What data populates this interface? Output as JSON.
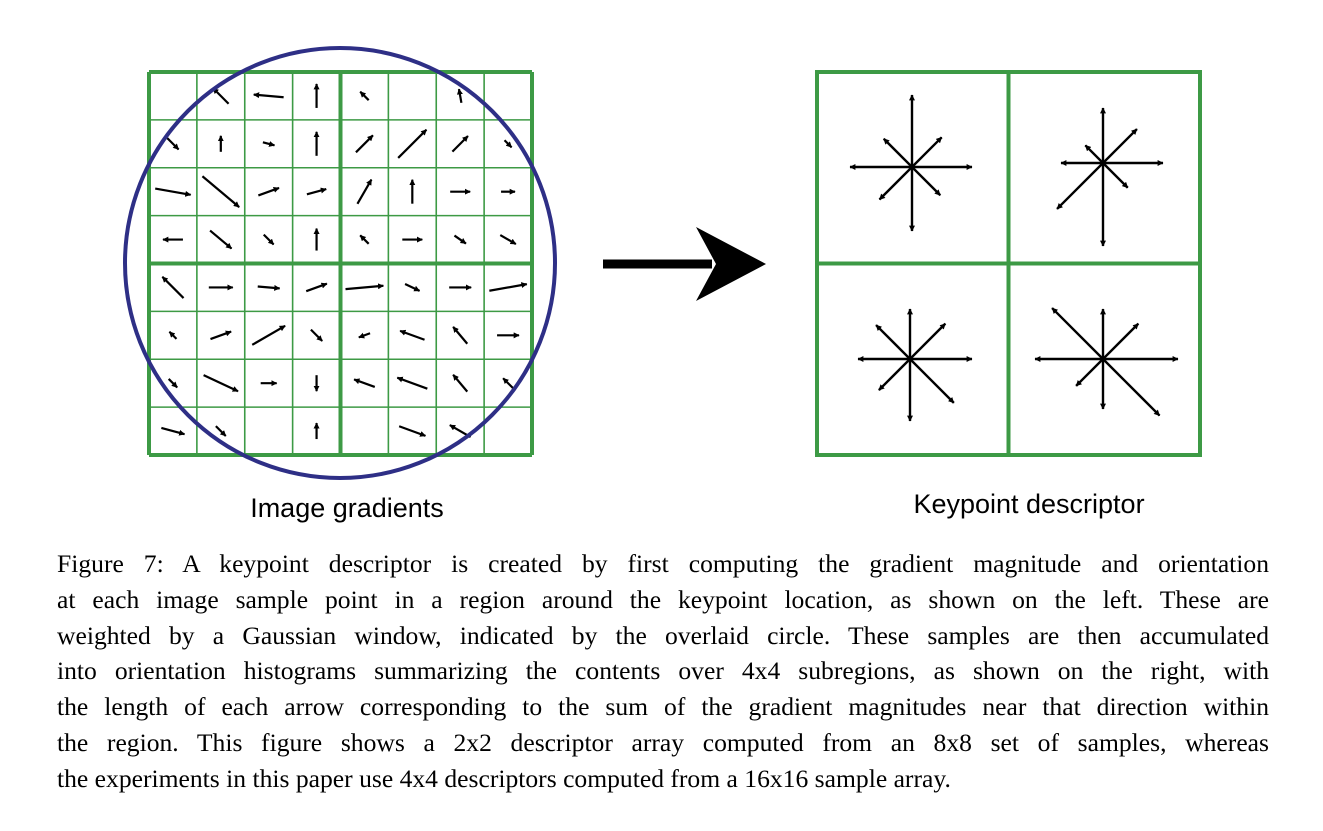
{
  "figure": {
    "left_label": "Image gradients",
    "right_label": "Keypoint descriptor",
    "colors": {
      "grid": "#3d9a45",
      "circle": "#2e2f86",
      "arrow": "#000000"
    }
  },
  "caption": {
    "lines": [
      "Figure 7: A keypoint descriptor is created by first computing the gradient magnitude and orientation",
      "at each image sample point in a region around the keypoint location, as shown on the left. These are",
      "weighted by a Gaussian window, indicated by the overlaid circle. These samples are then accumulated",
      "into orientation histograms summarizing the contents over 4x4 subregions, as shown on the right, with",
      "the length of each arrow corresponding to the sum of the gradient magnitudes near that direction within",
      "the region. This figure shows a 2x2 descriptor array computed from an 8x8 set of samples, whereas",
      "the experiments in this paper use 4x4 descriptors computed from a 16x16 sample array."
    ]
  }
}
